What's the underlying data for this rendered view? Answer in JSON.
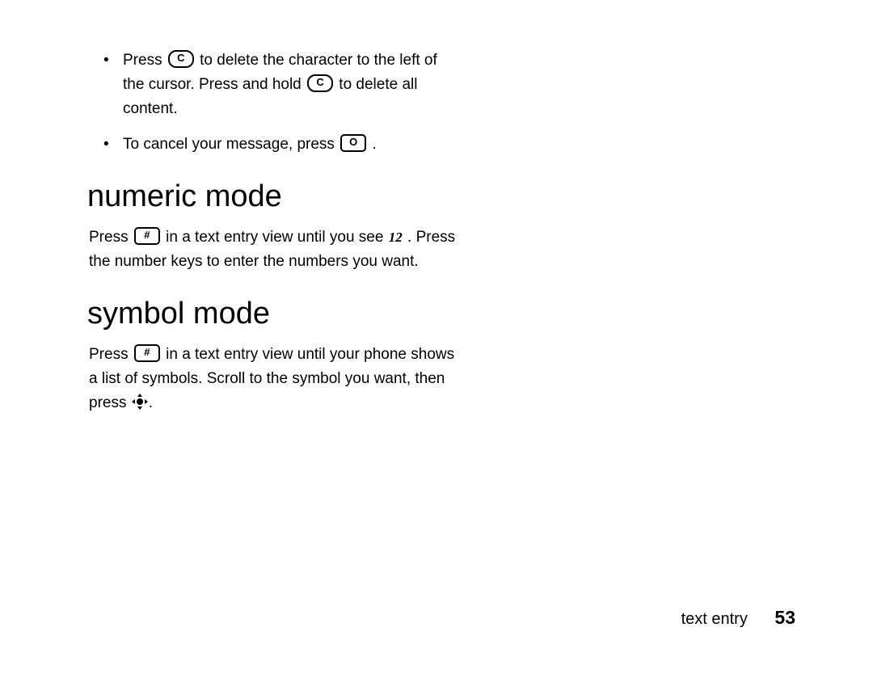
{
  "bullets": [
    {
      "pre": "Press ",
      "key1": "C",
      "mid1": " to delete the character to the left of the cursor. Press and hold ",
      "key2": "C",
      "mid2": " to delete all content."
    },
    {
      "pre": "To cancel your message, press ",
      "key1": "O",
      "post": "."
    }
  ],
  "sections": {
    "numeric": {
      "heading": "numeric mode",
      "para_pre": "Press ",
      "key": "#",
      "para_mid": " in a text entry view until you see ",
      "indicator": "12",
      "para_post": ". Press the number keys to enter the numbers you want."
    },
    "symbol": {
      "heading": "symbol mode",
      "para_pre": "Press ",
      "key": "#",
      "para_mid": " in a text entry view until your phone shows a list of symbols. Scroll to the symbol you want, then press ",
      "nav_icon": "center-select",
      "para_post": "."
    }
  },
  "footer": {
    "section": "text entry",
    "page": "53"
  }
}
